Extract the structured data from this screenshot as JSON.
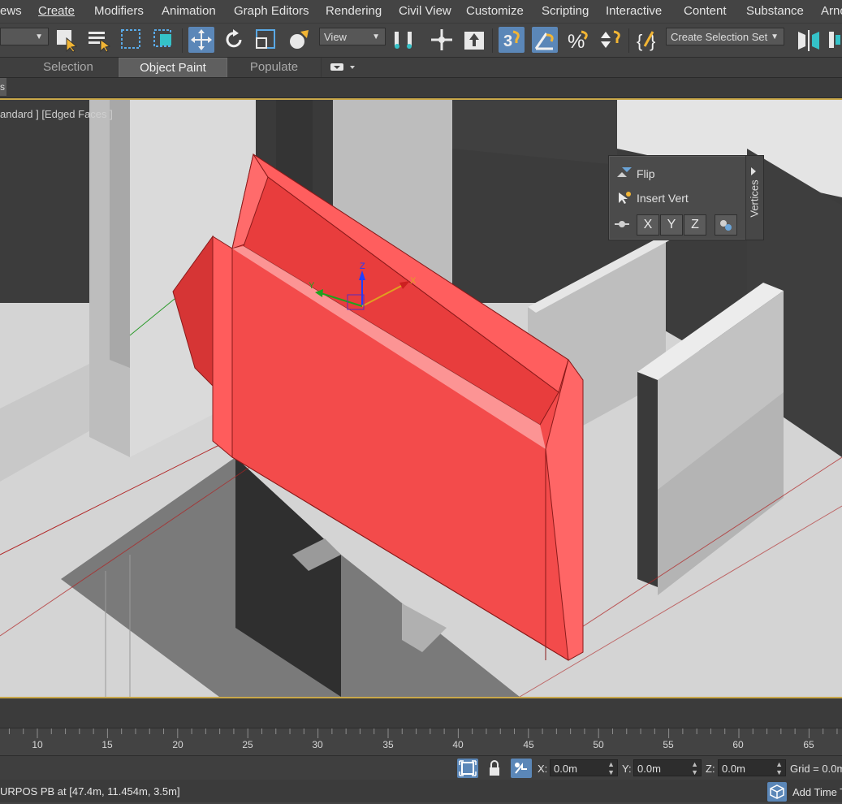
{
  "menu": {
    "items": [
      "ews",
      "Create",
      "Modifiers",
      "Animation",
      "Graph Editors",
      "Rendering",
      "Civil View",
      "Customize",
      "Scripting",
      "Interactive",
      "Content",
      "Substance",
      "Arno"
    ]
  },
  "toolbar": {
    "reference_coord": "View",
    "named_selection_placeholder": "Create Selection Set"
  },
  "ribbon": {
    "tabs": [
      "Selection",
      "Object Paint",
      "Populate"
    ],
    "active_tab": "Object Paint",
    "sub_tab": "s"
  },
  "viewport": {
    "label": "andard ] [Edged Faces ]",
    "object_color": "#f34b4b",
    "gizmo_axes": {
      "x": "X",
      "y": "Y",
      "z": "Z"
    }
  },
  "quad_menu": {
    "items": [
      "Flip",
      "Insert Vert"
    ],
    "axis_buttons": [
      "X",
      "Y",
      "Z"
    ],
    "side_label": "Vertices"
  },
  "timeline": {
    "ticks": [
      "10",
      "15",
      "20",
      "25",
      "30",
      "35",
      "40",
      "45",
      "50",
      "55",
      "60",
      "65"
    ]
  },
  "status": {
    "x_label": "X:",
    "x_value": "0.0m",
    "y_label": "Y:",
    "y_value": "0.0m",
    "z_label": "Z:",
    "z_value": "0.0m",
    "grid": "Grid = 0.0m",
    "prompt": "URPOS PB at [47.4m, 11.454m, 3.5m]",
    "add_time_tag": "Add Time Tag"
  },
  "colors": {
    "accent": "#5b87b8",
    "viewport_border": "#c9a84a",
    "object": "#f34b4b"
  }
}
